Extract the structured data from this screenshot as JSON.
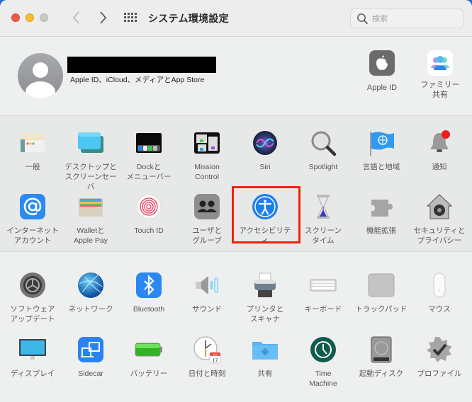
{
  "window": {
    "title": "システム環境設定",
    "search_placeholder": "検索",
    "nav": {
      "back": "back",
      "forward": "forward",
      "show_all": "show-all"
    }
  },
  "account": {
    "name": "[redacted]",
    "subtitle": "Apple ID、iCloud、メディアとApp Store",
    "items": [
      {
        "id": "apple-id",
        "label": "Apple ID",
        "icon": "apple-logo-icon"
      },
      {
        "id": "family-sharing",
        "label": "ファミリー\n共有",
        "icon": "family-icon"
      }
    ]
  },
  "section1": [
    {
      "id": "general",
      "label": "一般",
      "icon": "general-window-icon"
    },
    {
      "id": "desktop-screensaver",
      "label": "デスクトップと\nスクリーンセーバ",
      "icon": "desktop-icon"
    },
    {
      "id": "dock-menubar",
      "label": "Dockと\nメニューバー",
      "icon": "dock-icon"
    },
    {
      "id": "mission-control",
      "label": "Mission\nControl",
      "icon": "mission-control-icon"
    },
    {
      "id": "siri",
      "label": "Siri",
      "icon": "siri-icon"
    },
    {
      "id": "spotlight",
      "label": "Spotlight",
      "icon": "magnifier-icon"
    },
    {
      "id": "language-region",
      "label": "言語と地域",
      "icon": "globe-flag-icon"
    },
    {
      "id": "notifications",
      "label": "通知",
      "icon": "bell-icon"
    },
    {
      "id": "internet-accounts",
      "label": "インターネット\nアカウント",
      "icon": "at-sign-icon"
    },
    {
      "id": "wallet-applepay",
      "label": "Walletと\nApple Pay",
      "icon": "wallet-icon"
    },
    {
      "id": "touch-id",
      "label": "Touch ID",
      "icon": "fingerprint-icon"
    },
    {
      "id": "users-groups",
      "label": "ユーザと\nグループ",
      "icon": "users-icon"
    },
    {
      "id": "accessibility",
      "label": "アクセシビリティ",
      "icon": "accessibility-icon",
      "highlighted": true
    },
    {
      "id": "screen-time",
      "label": "スクリーン\nタイム",
      "icon": "hourglass-icon"
    },
    {
      "id": "extensions",
      "label": "機能拡張",
      "icon": "puzzle-icon"
    },
    {
      "id": "security-privacy",
      "label": "セキュリティと\nプライバシー",
      "icon": "house-safe-icon"
    }
  ],
  "section2": [
    {
      "id": "software-update",
      "label": "ソフトウェア\nアップデート",
      "icon": "gear-update-icon"
    },
    {
      "id": "network",
      "label": "ネットワーク",
      "icon": "network-globe-icon"
    },
    {
      "id": "bluetooth",
      "label": "Bluetooth",
      "icon": "bluetooth-icon"
    },
    {
      "id": "sound",
      "label": "サウンド",
      "icon": "speaker-icon"
    },
    {
      "id": "printers-scanners",
      "label": "プリンタと\nスキャナ",
      "icon": "printer-icon"
    },
    {
      "id": "keyboard",
      "label": "キーボード",
      "icon": "keyboard-icon"
    },
    {
      "id": "trackpad",
      "label": "トラックパッド",
      "icon": "trackpad-icon"
    },
    {
      "id": "mouse",
      "label": "マウス",
      "icon": "mouse-icon"
    },
    {
      "id": "displays",
      "label": "ディスプレイ",
      "icon": "display-icon"
    },
    {
      "id": "sidecar",
      "label": "Sidecar",
      "icon": "sidecar-icon"
    },
    {
      "id": "battery",
      "label": "バッテリー",
      "icon": "battery-icon"
    },
    {
      "id": "date-time",
      "label": "日付と時刻",
      "icon": "clock-calendar-icon",
      "calendar_month": "JUL",
      "calendar_day": "17"
    },
    {
      "id": "sharing",
      "label": "共有",
      "icon": "shared-folder-icon"
    },
    {
      "id": "time-machine",
      "label": "Time\nMachine",
      "icon": "time-machine-icon"
    },
    {
      "id": "startup-disk",
      "label": "起動ディスク",
      "icon": "hard-disk-icon"
    },
    {
      "id": "profiles",
      "label": "プロファイル",
      "icon": "checkmark-badge-icon"
    }
  ],
  "colors": {
    "highlight_box": "#f0220f",
    "close": "#ee5a52",
    "minimize": "#f5be2f",
    "zoom": "#c9c9c9"
  }
}
